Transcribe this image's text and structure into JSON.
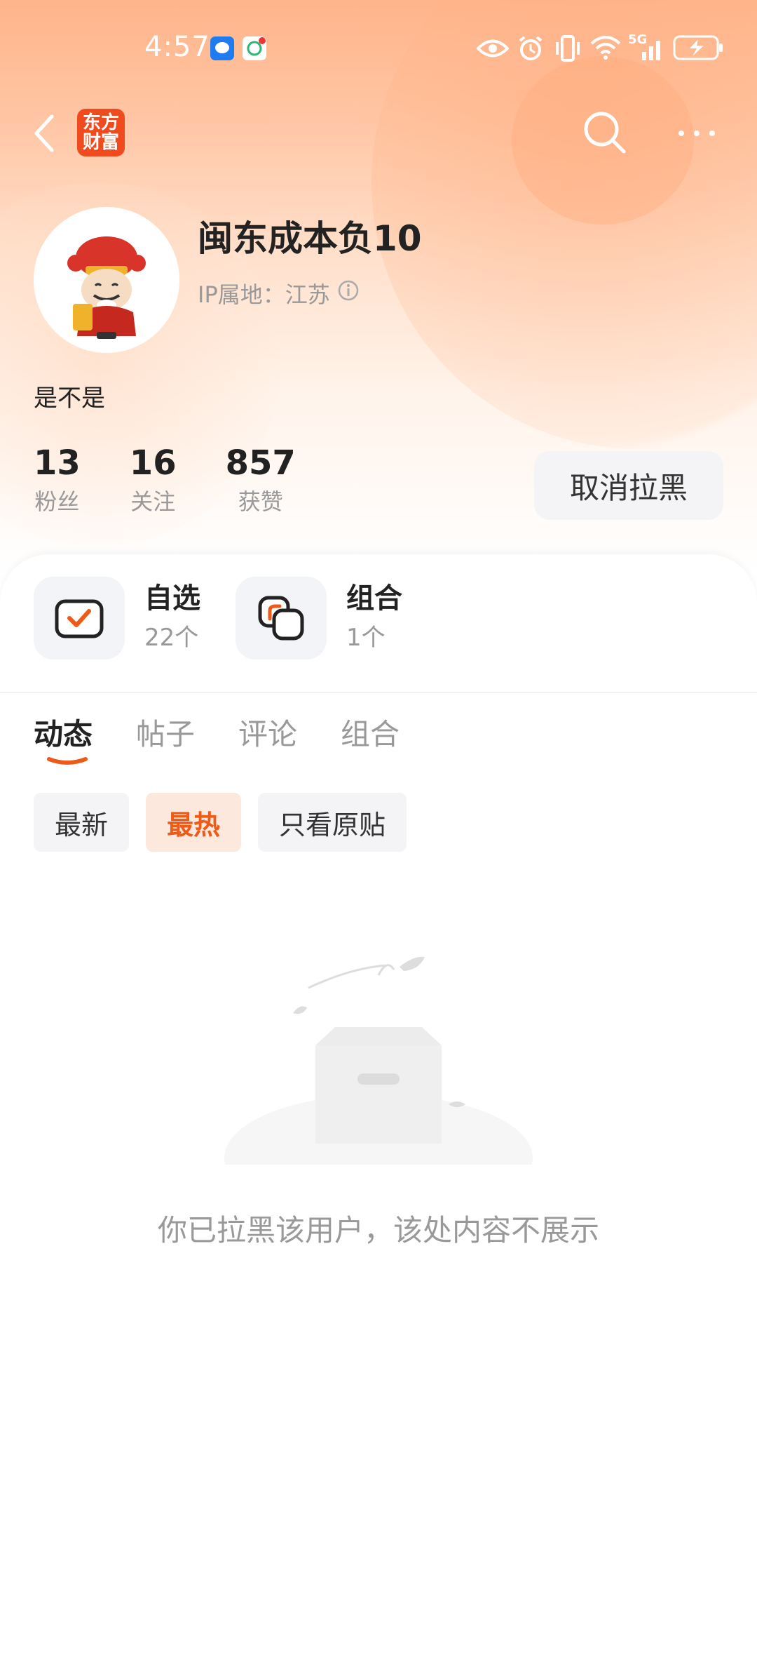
{
  "status_bar": {
    "time": "4:57",
    "network_label": "5G",
    "icons": [
      "message-icon",
      "app-notification-icon",
      "eye-icon",
      "alarm-icon",
      "vibrate-icon",
      "wifi-icon",
      "signal-icon",
      "battery-charging-icon"
    ]
  },
  "nav": {
    "logo_line1": "东方",
    "logo_line2": "财富",
    "brand_color": "#ef4b1e"
  },
  "profile": {
    "username": "闽东成本负10",
    "ip_location": "IP属地：江苏",
    "bio": "是不是",
    "stats": [
      {
        "value": "13",
        "label": "粉丝"
      },
      {
        "value": "16",
        "label": "关注"
      },
      {
        "value": "857",
        "label": "获赞"
      }
    ],
    "unblock_label": "取消拉黑"
  },
  "entries": [
    {
      "title": "自选",
      "count": "22个"
    },
    {
      "title": "组合",
      "count": "1个"
    }
  ],
  "tabs": [
    {
      "label": "动态",
      "active": true
    },
    {
      "label": "帖子",
      "active": false
    },
    {
      "label": "评论",
      "active": false
    },
    {
      "label": "组合",
      "active": false
    }
  ],
  "filters": [
    {
      "label": "最新",
      "active": false
    },
    {
      "label": "最热",
      "active": true
    },
    {
      "label": "只看原贴",
      "active": false
    }
  ],
  "empty_state": {
    "message": "你已拉黑该用户，该处内容不展示"
  },
  "colors": {
    "accent": "#ee5a17",
    "header_top": "#ffb48a"
  }
}
